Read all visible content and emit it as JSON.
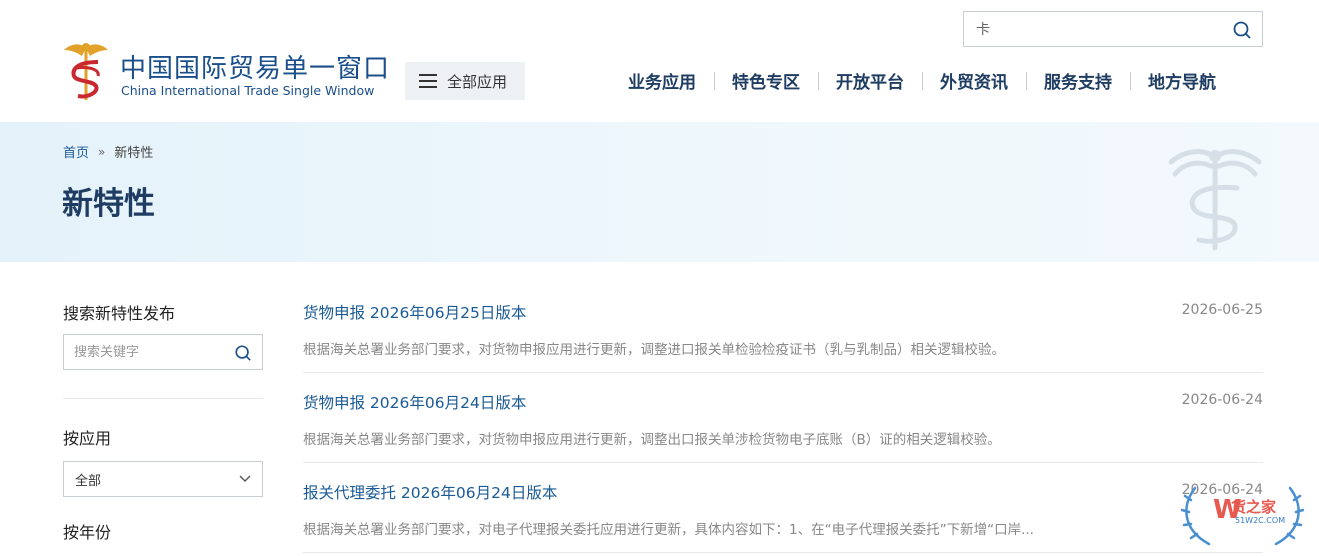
{
  "brand": {
    "name_cn": "中国国际贸易单一窗口",
    "name_en": "China International Trade Single Window"
  },
  "header": {
    "all_apps_label": "全部应用",
    "search_value": "卡",
    "nav": [
      {
        "label": "业务应用"
      },
      {
        "label": "特色专区"
      },
      {
        "label": "开放平台"
      },
      {
        "label": "外贸资讯"
      },
      {
        "label": "服务支持"
      },
      {
        "label": "地方导航"
      }
    ]
  },
  "breadcrumb": {
    "home": "首页",
    "separator": "»",
    "current": "新特性"
  },
  "page_title": "新特性",
  "sidebar": {
    "search_heading": "搜索新特性发布",
    "search_placeholder": "搜索关键字",
    "app_heading": "按应用",
    "app_selected": "全部",
    "year_heading": "按年份"
  },
  "news": [
    {
      "title": "货物申报 2026年06月25日版本",
      "date": "2026-06-25",
      "desc": "根据海关总署业务部门要求，对货物申报应用进行更新，调整进口报关单检验检疫证书（乳与乳制品）相关逻辑校验。"
    },
    {
      "title": "货物申报 2026年06月24日版本",
      "date": "2026-06-24",
      "desc": "根据海关总署业务部门要求，对货物申报应用进行更新，调整出口报关单涉检货物电子底账（B）证的相关逻辑校验。"
    },
    {
      "title": "报关代理委托 2026年06月24日版本",
      "date": "2026-06-24",
      "desc": "根据海关总署业务部门要求，对电子代理报关委托应用进行更新，具体内容如下：1、在“电子代理报关委托”下新增“口岸..."
    }
  ],
  "watermark": {
    "cn": "货之家",
    "en": "51W2C.COM"
  },
  "colors": {
    "brand_blue": "#1a4f8a",
    "nav_text": "#1f3d63",
    "link_blue": "#1a5a96",
    "banner_bg": "#e4f2fa",
    "muted_text": "#888888",
    "logo_gold": "#e2a22a",
    "logo_red": "#c8282e"
  }
}
